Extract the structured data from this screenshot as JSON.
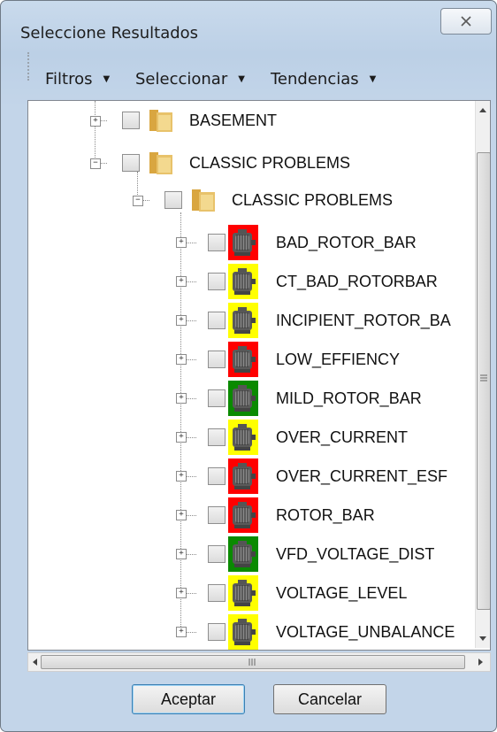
{
  "window": {
    "title": "Seleccione Resultados"
  },
  "menu": [
    {
      "label": "Filtros"
    },
    {
      "label": "Seleccionar"
    },
    {
      "label": "Tendencias"
    }
  ],
  "tree": {
    "folders": [
      {
        "label": "BASEMENT",
        "expander": "+"
      },
      {
        "label": "CLASSIC PROBLEMS",
        "expander": "−"
      },
      {
        "label": "CLASSIC PROBLEMS",
        "expander": "−"
      }
    ],
    "items": [
      {
        "label": "BAD_ROTOR_BAR",
        "status": "red",
        "color": "#ff0000"
      },
      {
        "label": "CT_BAD_ROTORBAR",
        "status": "yellow",
        "color": "#ffff00"
      },
      {
        "label": "INCIPIENT_ROTOR_BA",
        "status": "yellow",
        "color": "#ffff00"
      },
      {
        "label": "LOW_EFFIENCY",
        "status": "red",
        "color": "#ff0000"
      },
      {
        "label": "MILD_ROTOR_BAR",
        "status": "green",
        "color": "#0a8a00"
      },
      {
        "label": "OVER_CURRENT",
        "status": "yellow",
        "color": "#ffff00"
      },
      {
        "label": "OVER_CURRENT_ESF",
        "status": "red",
        "color": "#ff0000"
      },
      {
        "label": "ROTOR_BAR",
        "status": "red",
        "color": "#ff0000"
      },
      {
        "label": "VFD_VOLTAGE_DIST",
        "status": "green",
        "color": "#0a8a00"
      },
      {
        "label": "VOLTAGE_LEVEL",
        "status": "yellow",
        "color": "#ffff00"
      },
      {
        "label": "VOLTAGE_UNBALANCE",
        "status": "yellow",
        "color": "#ffff00"
      }
    ]
  },
  "buttons": {
    "ok": "Aceptar",
    "cancel": "Cancelar"
  },
  "icons": {
    "close": "close-icon",
    "folder": "folder-icon",
    "motor": "motor-icon"
  }
}
